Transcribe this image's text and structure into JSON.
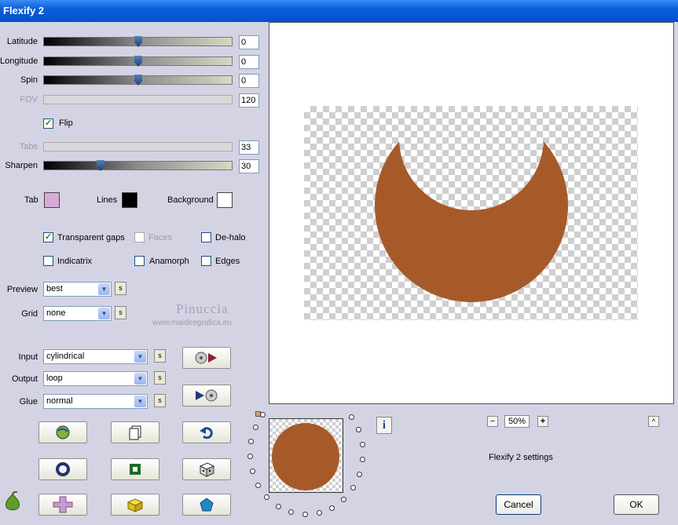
{
  "window": {
    "title": "Flexify 2"
  },
  "sliders": [
    {
      "label": "Latitude",
      "value": "0",
      "enabled": true,
      "level": 0.5
    },
    {
      "label": "Longitude",
      "value": "0",
      "enabled": true,
      "level": 0.5
    },
    {
      "label": "Spin",
      "value": "0",
      "enabled": true,
      "level": 0.5
    },
    {
      "label": "FOV",
      "value": "120",
      "enabled": false,
      "level": 0
    },
    {
      "label": "Tabs",
      "value": "33",
      "enabled": false,
      "level": 0
    },
    {
      "label": "Sharpen",
      "value": "30",
      "enabled": true,
      "level": 0.3
    }
  ],
  "flip": {
    "label": "Flip",
    "checked": true
  },
  "colors": {
    "tab": {
      "label": "Tab",
      "color": "#d9a9d9"
    },
    "lines": {
      "label": "Lines",
      "color": "#000000"
    },
    "background": {
      "label": "Background",
      "color": "#ffffff"
    }
  },
  "options": {
    "transparent_gaps": {
      "label": "Transparent gaps",
      "checked": true
    },
    "faces": {
      "label": "Faces",
      "checked": false
    },
    "dehalo": {
      "label": "De-halo",
      "checked": false
    },
    "indicatrix": {
      "label": "Indicatrix",
      "checked": false
    },
    "anamorph": {
      "label": "Anamorph",
      "checked": false
    },
    "edges": {
      "label": "Edges",
      "checked": false
    }
  },
  "preview_select": {
    "label": "Preview",
    "value": "best"
  },
  "grid_select": {
    "label": "Grid",
    "value": "none"
  },
  "input_select": {
    "label": "Input",
    "value": "cylindrical"
  },
  "output_select": {
    "label": "Output",
    "value": "loop"
  },
  "glue_select": {
    "label": "Glue",
    "value": "normal"
  },
  "save_btn": "s",
  "watermark": {
    "line1": "Pinuccia",
    "line2": "www.maidiregrafica.eu"
  },
  "zoom": {
    "value": "50%",
    "minus": "−",
    "plus": "+"
  },
  "up_btn": "^",
  "info_btn": "i",
  "settings_name": "Flexify 2 settings",
  "buttons": {
    "cancel": "Cancel",
    "ok": "OK"
  },
  "image": {
    "crescent_color": "#a65a2a"
  }
}
